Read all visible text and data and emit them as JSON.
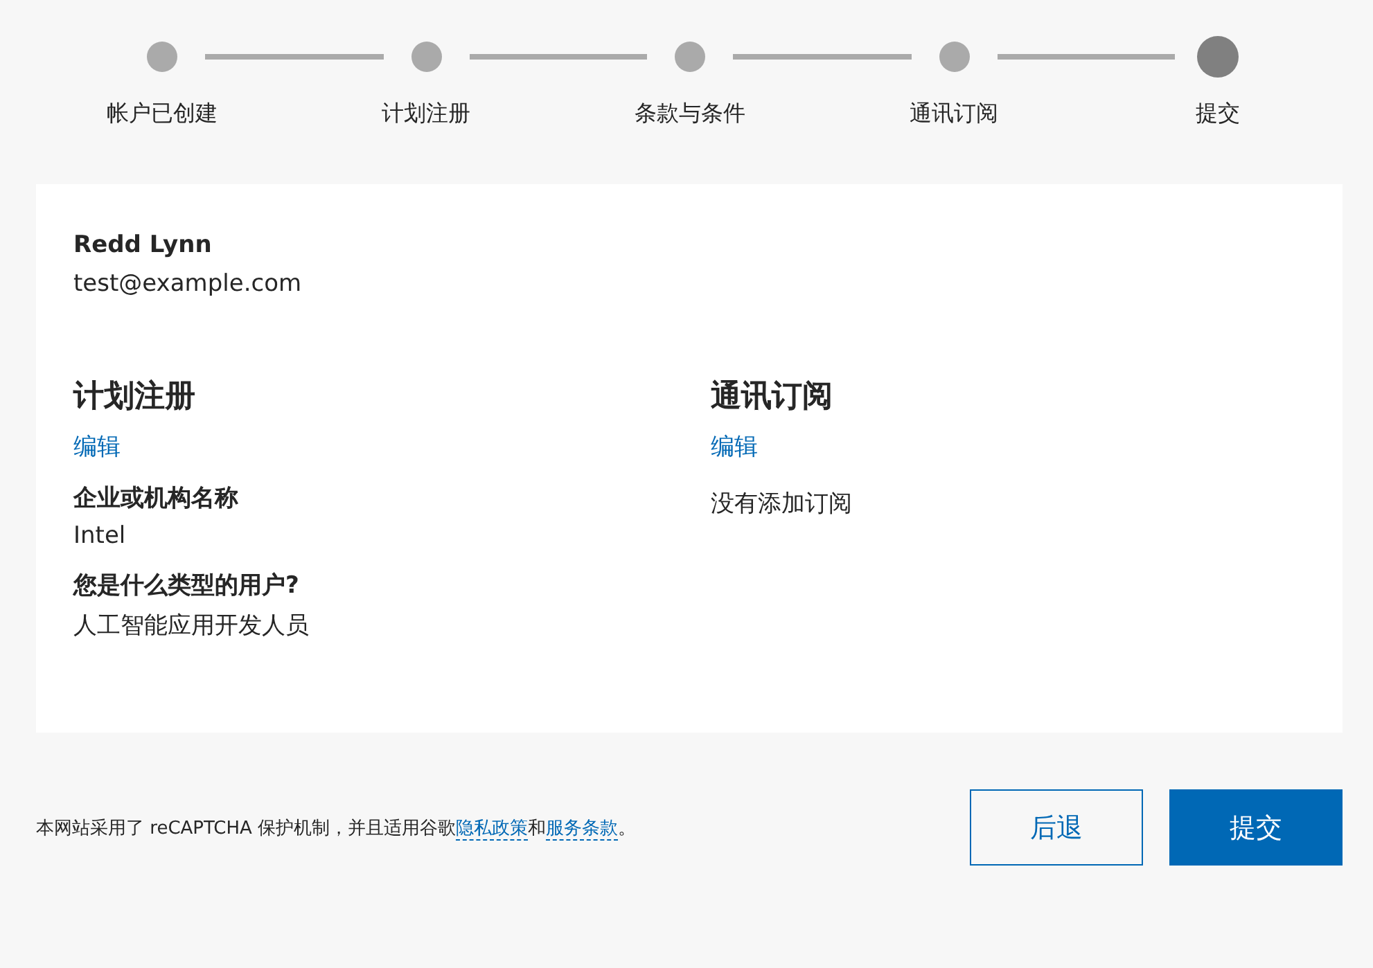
{
  "steps": [
    {
      "label": "帐户已创建",
      "selected": false
    },
    {
      "label": "计划注册",
      "selected": false
    },
    {
      "label": "条款与条件",
      "selected": false
    },
    {
      "label": "通讯订阅",
      "selected": false
    },
    {
      "label": "提交",
      "selected": true
    }
  ],
  "summary": {
    "name": "Redd Lynn",
    "email": "test@example.com",
    "sections": [
      {
        "title": "计划注册",
        "edit": "编辑",
        "fields": [
          {
            "label": "企业或机构名称",
            "value": "Intel"
          },
          {
            "label": "您是什么类型的用户?",
            "value": "人工智能应用开发人员"
          }
        ]
      },
      {
        "title": "通讯订阅",
        "edit": "编辑",
        "note": "没有添加订阅"
      }
    ]
  },
  "footer": {
    "text_before": "本网站采用了 reCAPTCHA 保护机制，并且适用谷歌",
    "privacy_link": "隐私政策",
    "text_middle": "和",
    "terms_link": "服务条款",
    "text_after": "。"
  },
  "buttons": {
    "back": "后退",
    "submit": "提交"
  }
}
